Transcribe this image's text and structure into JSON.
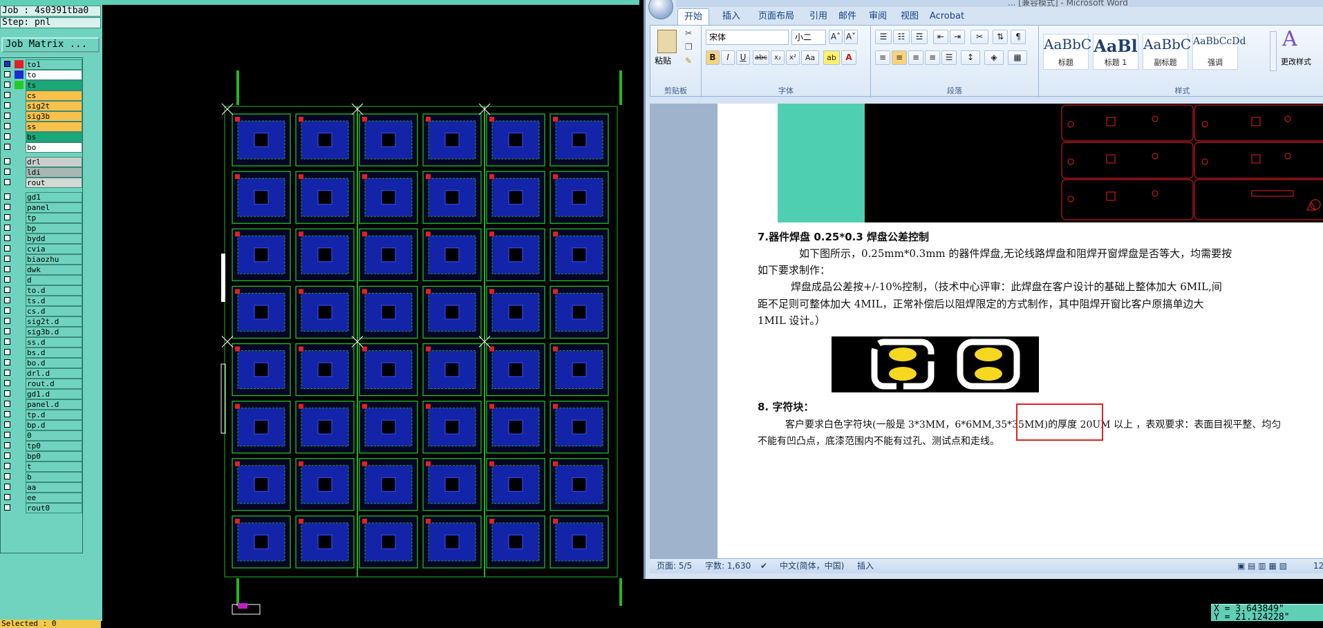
{
  "cam": {
    "job_label": "Job : 4s0391tba0",
    "step_label": "Step: pnl",
    "job_matrix": "Job Matrix ...",
    "selected": "Selected : 0",
    "layers": [
      {
        "name": "to1",
        "bg": "#6fd3bf",
        "c1": "#1b2fd0",
        "c2": "#e42020",
        "highlight": true
      },
      {
        "name": "to",
        "bg": "#ffffff",
        "c2": "#1b2fd0"
      },
      {
        "name": "ts",
        "bg": "#1aa878",
        "c2": "#22cc22"
      },
      {
        "name": "cs",
        "bg": "#f7c14b"
      },
      {
        "name": "sig2t",
        "bg": "#f7c14b"
      },
      {
        "name": "sig3b",
        "bg": "#f7c14b"
      },
      {
        "name": "ss",
        "bg": "#f7c14b"
      },
      {
        "name": "bs",
        "bg": "#1aa878"
      },
      {
        "name": "bo",
        "bg": "#ffffff"
      },
      {
        "name": "drl",
        "bg": "#c9cdcb",
        "gap": true
      },
      {
        "name": "ldi",
        "bg": "#a7b7b3"
      },
      {
        "name": "rout",
        "bg": "#d4d8d6"
      },
      {
        "name": "gd1",
        "bg": "#6fd3bf",
        "gap": true
      },
      {
        "name": "panel",
        "bg": "#6fd3bf"
      },
      {
        "name": "tp",
        "bg": "#6fd3bf"
      },
      {
        "name": "bp",
        "bg": "#6fd3bf"
      },
      {
        "name": "bydd",
        "bg": "#6fd3bf"
      },
      {
        "name": "cvia",
        "bg": "#6fd3bf"
      },
      {
        "name": "biaozhu",
        "bg": "#6fd3bf"
      },
      {
        "name": "dwk",
        "bg": "#6fd3bf"
      },
      {
        "name": "d",
        "bg": "#6fd3bf"
      },
      {
        "name": "to.d",
        "bg": "#6fd3bf"
      },
      {
        "name": "ts.d",
        "bg": "#6fd3bf"
      },
      {
        "name": "cs.d",
        "bg": "#6fd3bf"
      },
      {
        "name": "sig2t.d",
        "bg": "#6fd3bf"
      },
      {
        "name": "sig3b.d",
        "bg": "#6fd3bf"
      },
      {
        "name": "ss.d",
        "bg": "#6fd3bf"
      },
      {
        "name": "bs.d",
        "bg": "#6fd3bf"
      },
      {
        "name": "bo.d",
        "bg": "#6fd3bf"
      },
      {
        "name": "drl.d",
        "bg": "#6fd3bf"
      },
      {
        "name": "rout.d",
        "bg": "#6fd3bf"
      },
      {
        "name": "gd1.d",
        "bg": "#6fd3bf"
      },
      {
        "name": "panel.d",
        "bg": "#6fd3bf"
      },
      {
        "name": "tp.d",
        "bg": "#6fd3bf"
      },
      {
        "name": "bp.d",
        "bg": "#6fd3bf"
      },
      {
        "name": "0",
        "bg": "#6fd3bf"
      },
      {
        "name": "tp0",
        "bg": "#6fd3bf"
      },
      {
        "name": "bp0",
        "bg": "#6fd3bf"
      },
      {
        "name": "t",
        "bg": "#6fd3bf"
      },
      {
        "name": "b",
        "bg": "#6fd3bf"
      },
      {
        "name": "aa",
        "bg": "#6fd3bf"
      },
      {
        "name": "ee",
        "bg": "#6fd3bf"
      },
      {
        "name": "rout0",
        "bg": "#6fd3bf"
      }
    ],
    "panel_grid": {
      "cols": 6,
      "rows": 8
    },
    "coord_x": "X = 3.643849\"",
    "coord_y": "Y = 21.124228\""
  },
  "word": {
    "title_fragment": "... [兼容模式] - Microsoft Word",
    "tabs": [
      "开始",
      "插入",
      "页面布局",
      "引用",
      "邮件",
      "审阅",
      "视图",
      "Acrobat"
    ],
    "clipboard": {
      "paste": "粘贴",
      "label": "剪贴板"
    },
    "font": {
      "name": "宋体",
      "size": "小二",
      "label": "字体"
    },
    "paragraph_label": "段落",
    "styles": {
      "label": "样式",
      "items": [
        {
          "sample": "AaBbC",
          "cap": "标题"
        },
        {
          "sample": "AaBl",
          "cap": "标题 1"
        },
        {
          "sample": "AaBbC",
          "cap": "副标题"
        },
        {
          "sample": "AaBbCcDd",
          "cap": "强调"
        }
      ],
      "change": "更改样式"
    },
    "doc": {
      "h7": "7.器件焊盘 0.25*0.3 焊盘公差控制",
      "p7a": "如下图所示，0.25mm*0.3mm 的器件焊盘,无论线路焊盘和阻焊开窗焊盘是否等大，均需要按",
      "p7b": "如下要求制作：",
      "p7c": "焊盘成品公差按+/-10%控制，（技术中心评审：此焊盘在客户设计的基础上整体加大 6MIL,间",
      "p7d": "距不足则可整体加大 4MIL，正常补偿后以阻焊限定的方式制作，其中阻焊开窗比客户原搞单边大",
      "p7e": "1MIL 设计。）",
      "h8": "8. 字符块：",
      "p8a": "客户要求白色字符块(一般是 3*3MM，6*6MM,35*35MM)的厚度 20UM 以上 ，表观要求：表面目视平整、均匀",
      "p8b": "不能有凹凸点，底漆范围内不能有过孔、测试点和走线。"
    },
    "status": {
      "page": "页面: 5/5",
      "words": "字数: 1,630",
      "lang": "中文(简体，中国)",
      "mode": "插入",
      "zoom": "12"
    }
  }
}
